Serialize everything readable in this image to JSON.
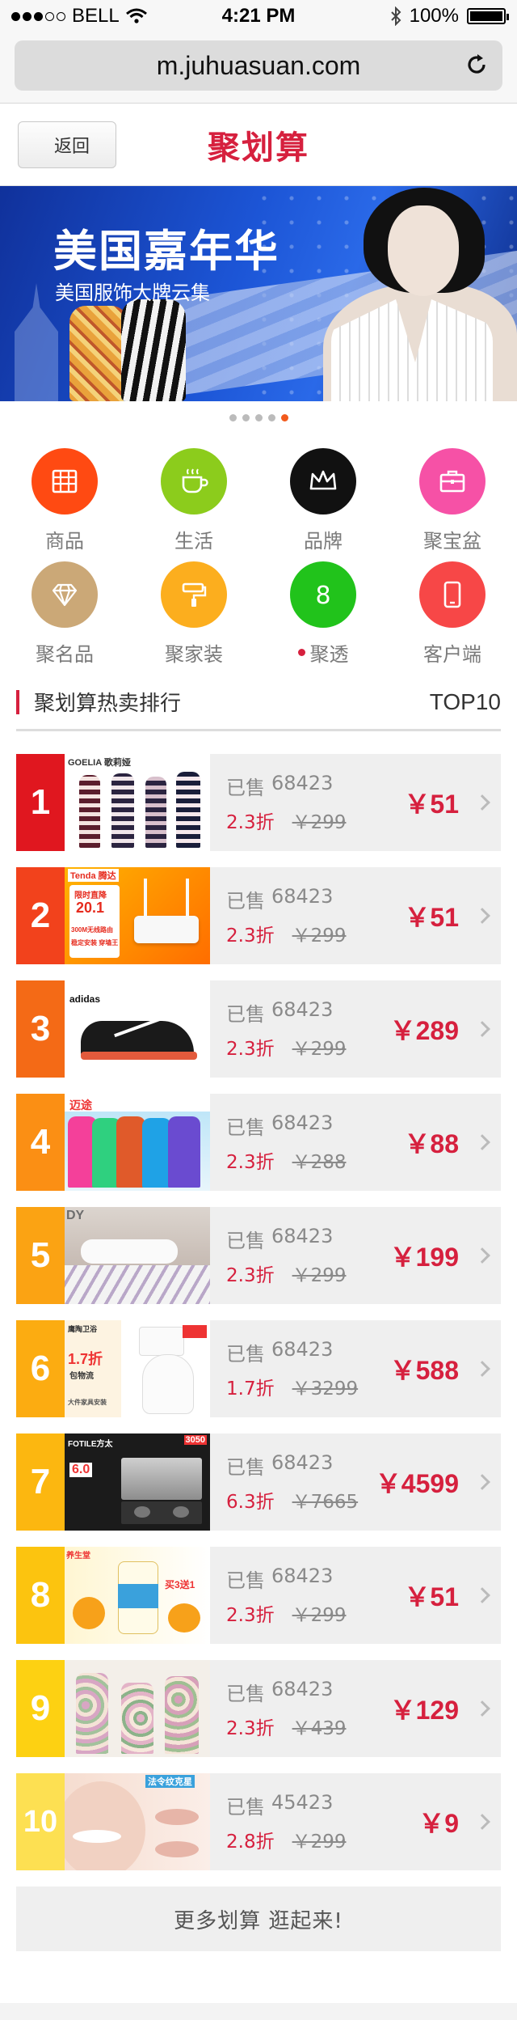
{
  "status_bar": {
    "carrier": "BELL",
    "time": "4:21 PM",
    "battery": "100%",
    "signal_bars": 3,
    "battery_level": 1.0
  },
  "address_bar": {
    "url": "m.juhuasuan.com"
  },
  "nav": {
    "back_label": "返回",
    "logo_text": "聚划算"
  },
  "banner": {
    "title": "美国嘉年华",
    "subtitle": "美国服饰大牌云集",
    "page_count": 5,
    "active_page": 5
  },
  "categories": [
    {
      "label": "商品",
      "icon": "calendar-grid-icon",
      "color": "#ff4a12"
    },
    {
      "label": "生活",
      "icon": "coffee-cup-icon",
      "color": "#8ccc1c"
    },
    {
      "label": "品牌",
      "icon": "crown-icon",
      "color": "#111111"
    },
    {
      "label": "聚宝盆",
      "icon": "briefcase-icon",
      "color": "#f651a6"
    },
    {
      "label": "聚名品",
      "icon": "diamond-icon",
      "color": "#cba877"
    },
    {
      "label": "聚家装",
      "icon": "paint-roller-icon",
      "color": "#fcae1e"
    },
    {
      "label": "聚透",
      "icon": "number-8-icon",
      "color": "#21c31b",
      "glyph": "8",
      "has_dot": true
    },
    {
      "label": "客户端",
      "icon": "mobile-phone-icon",
      "color": "#f74747"
    }
  ],
  "ranking": {
    "title": "聚划算热卖排行",
    "badge": "TOP10",
    "sold_prefix": "已售",
    "items": [
      {
        "rank": "1",
        "sold": "68423",
        "discount": "2.3折",
        "original": "￥299",
        "price": "￥51",
        "color": "#e0171f",
        "thumb_brand": "GOELIA 歌莉娅"
      },
      {
        "rank": "2",
        "sold": "68423",
        "discount": "2.3折",
        "original": "￥299",
        "price": "￥51",
        "color": "#f2421c",
        "thumb_brand": "Tenda 腾达",
        "thumb_lines": [
          "限时直降",
          "20.1",
          "300M无线路由",
          "稳定安装 穿墙王"
        ]
      },
      {
        "rank": "3",
        "sold": "68423",
        "discount": "2.3折",
        "original": "￥299",
        "price": "￥289",
        "color": "#f46a16",
        "thumb_brand": "adidas"
      },
      {
        "rank": "4",
        "sold": "68423",
        "discount": "2.3折",
        "original": "￥288",
        "price": "￥88",
        "color": "#fb8f14",
        "thumb_brand": "迈途"
      },
      {
        "rank": "5",
        "sold": "68423",
        "discount": "2.3折",
        "original": "￥299",
        "price": "￥199",
        "color": "#fba313",
        "thumb_brand": "DY"
      },
      {
        "rank": "6",
        "sold": "68423",
        "discount": "1.7折",
        "original": "￥3299",
        "price": "￥588",
        "color": "#fcac11",
        "thumb_brand": "鹰陶卫浴",
        "thumb_lines": [
          "1.7折",
          "包物流",
          "大件家具安装"
        ]
      },
      {
        "rank": "7",
        "sold": "68423",
        "discount": "6.3折",
        "original": "￥7665",
        "price": "￥4599",
        "color": "#fcb710",
        "thumb_brand": "FOTILE方太",
        "thumb_lines": [
          "6.0",
          "3050"
        ]
      },
      {
        "rank": "8",
        "sold": "68423",
        "discount": "2.3折",
        "original": "￥299",
        "price": "￥51",
        "color": "#fcc40f",
        "thumb_brand": "养生堂",
        "thumb_lines": [
          "买3送1"
        ]
      },
      {
        "rank": "9",
        "sold": "68423",
        "discount": "2.3折",
        "original": "￥439",
        "price": "￥129",
        "color": "#fdd112",
        "thumb_brand": ""
      },
      {
        "rank": "10",
        "sold": "45423",
        "discount": "2.8折",
        "original": "￥299",
        "price": "￥9",
        "color": "#fde052",
        "thumb_brand": "法令纹克星"
      }
    ]
  },
  "more_button": "更多划算  逛起来!"
}
